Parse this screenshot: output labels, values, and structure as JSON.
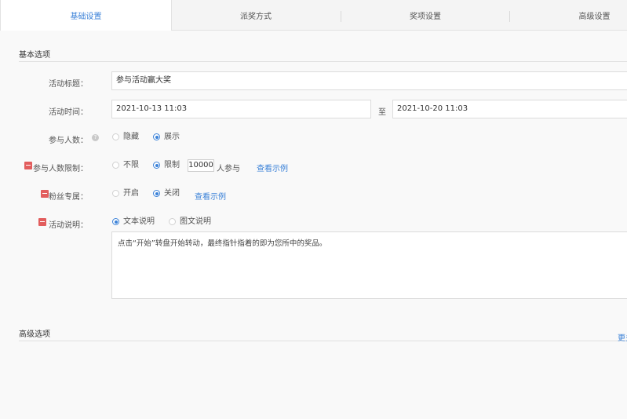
{
  "tabs": [
    {
      "label": "基础设置"
    },
    {
      "label": "派奖方式"
    },
    {
      "label": "奖项设置"
    },
    {
      "label": "高级设置"
    }
  ],
  "basic_section": {
    "title": "基本选项"
  },
  "fields": {
    "title": {
      "label": "活动标题：",
      "value": "参与活动赢大奖"
    },
    "time": {
      "label": "活动时间：",
      "start": "2021-10-13 11:03",
      "separator": "至",
      "end": "2021-10-20 11:03"
    },
    "participants": {
      "label": "参与人数：",
      "options": [
        "隐藏",
        "展示"
      ],
      "selected": "展示"
    },
    "limit": {
      "label": "参与人数限制：",
      "options": [
        "不限",
        "限制"
      ],
      "selected": "限制",
      "count": "10000",
      "suffix": "人参与",
      "example_link": "查看示例"
    },
    "fans": {
      "label": "粉丝专属：",
      "options": [
        "开启",
        "关闭"
      ],
      "selected": "关闭",
      "example_link": "查看示例"
    },
    "description": {
      "label": "活动说明：",
      "options": [
        "文本说明",
        "图文说明"
      ],
      "selected": "文本说明",
      "text": "点击“开始”转盘开始转动，最终指针指着的即为您所中的奖品。"
    }
  },
  "advanced_section": {
    "title": "高级选项",
    "more_link": "更多"
  },
  "colors": {
    "accent": "#3c82d8",
    "required": "#e25d5d"
  },
  "icons": {
    "help": "question-circle-icon",
    "required": "required-marker-icon"
  }
}
